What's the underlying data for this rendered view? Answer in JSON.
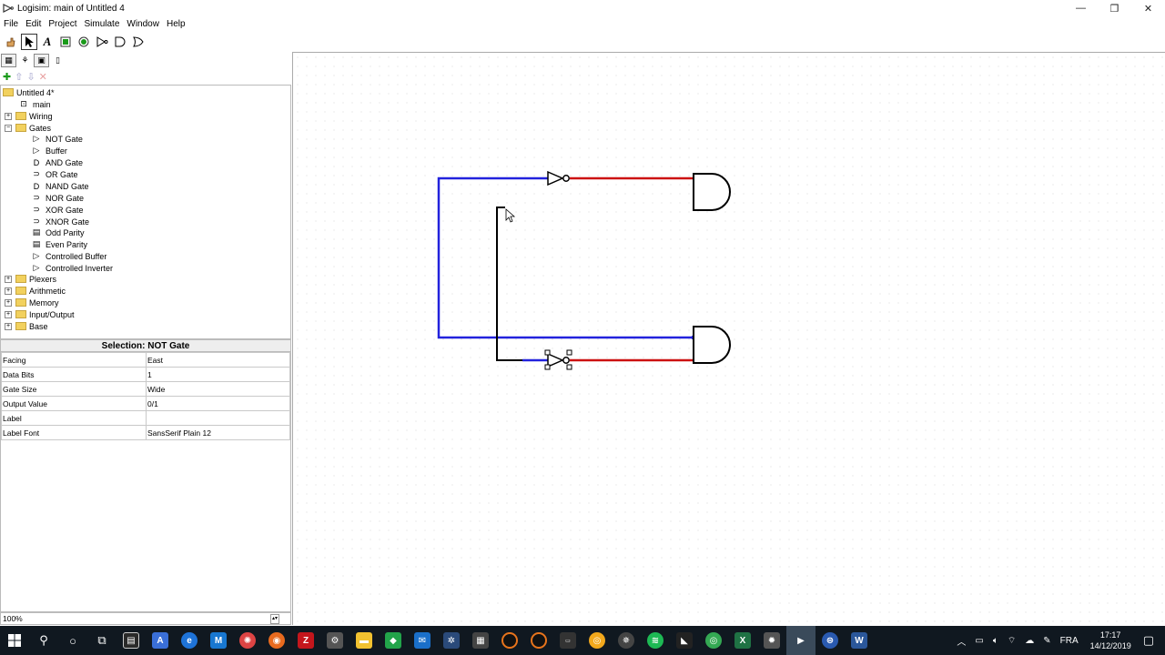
{
  "window": {
    "title": "Logisim: main of Untitled 4",
    "controls": [
      "—",
      "❐",
      "✕"
    ]
  },
  "menu": [
    "File",
    "Edit",
    "Project",
    "Simulate",
    "Window",
    "Help"
  ],
  "explorer": {
    "project": "Untitled 4*",
    "circuit": "main",
    "folders_top": [
      "Wiring",
      "Gates"
    ],
    "gates": [
      {
        "label": "NOT Gate",
        "icon": "▷"
      },
      {
        "label": "Buffer",
        "icon": "▷"
      },
      {
        "label": "AND Gate",
        "icon": "D"
      },
      {
        "label": "OR Gate",
        "icon": "⊃"
      },
      {
        "label": "NAND Gate",
        "icon": "D"
      },
      {
        "label": "NOR Gate",
        "icon": "⊃"
      },
      {
        "label": "XOR Gate",
        "icon": "⊃"
      },
      {
        "label": "XNOR Gate",
        "icon": "⊃"
      },
      {
        "label": "Odd Parity",
        "icon": "▤"
      },
      {
        "label": "Even Parity",
        "icon": "▤"
      },
      {
        "label": "Controlled Buffer",
        "icon": "▷"
      },
      {
        "label": "Controlled Inverter",
        "icon": "▷"
      }
    ],
    "folders_bottom": [
      "Plexers",
      "Arithmetic",
      "Memory",
      "Input/Output",
      "Base"
    ]
  },
  "attributes": {
    "title": "Selection: NOT Gate",
    "rows": [
      {
        "name": "Facing",
        "value": "East"
      },
      {
        "name": "Data Bits",
        "value": "1"
      },
      {
        "name": "Gate Size",
        "value": "Wide"
      },
      {
        "name": "Output Value",
        "value": "0/1"
      },
      {
        "name": "Label",
        "value": ""
      },
      {
        "name": "Label Font",
        "value": "SansSerif Plain 12"
      }
    ]
  },
  "zoom": "100%",
  "colors": {
    "wire_blue": "#2222dd",
    "wire_red": "#cc1111",
    "wire_black": "#000000",
    "taskbar": "#101820"
  },
  "taskbar": {
    "language": "FRA",
    "time": "17:17",
    "date": "14/12/2019"
  }
}
